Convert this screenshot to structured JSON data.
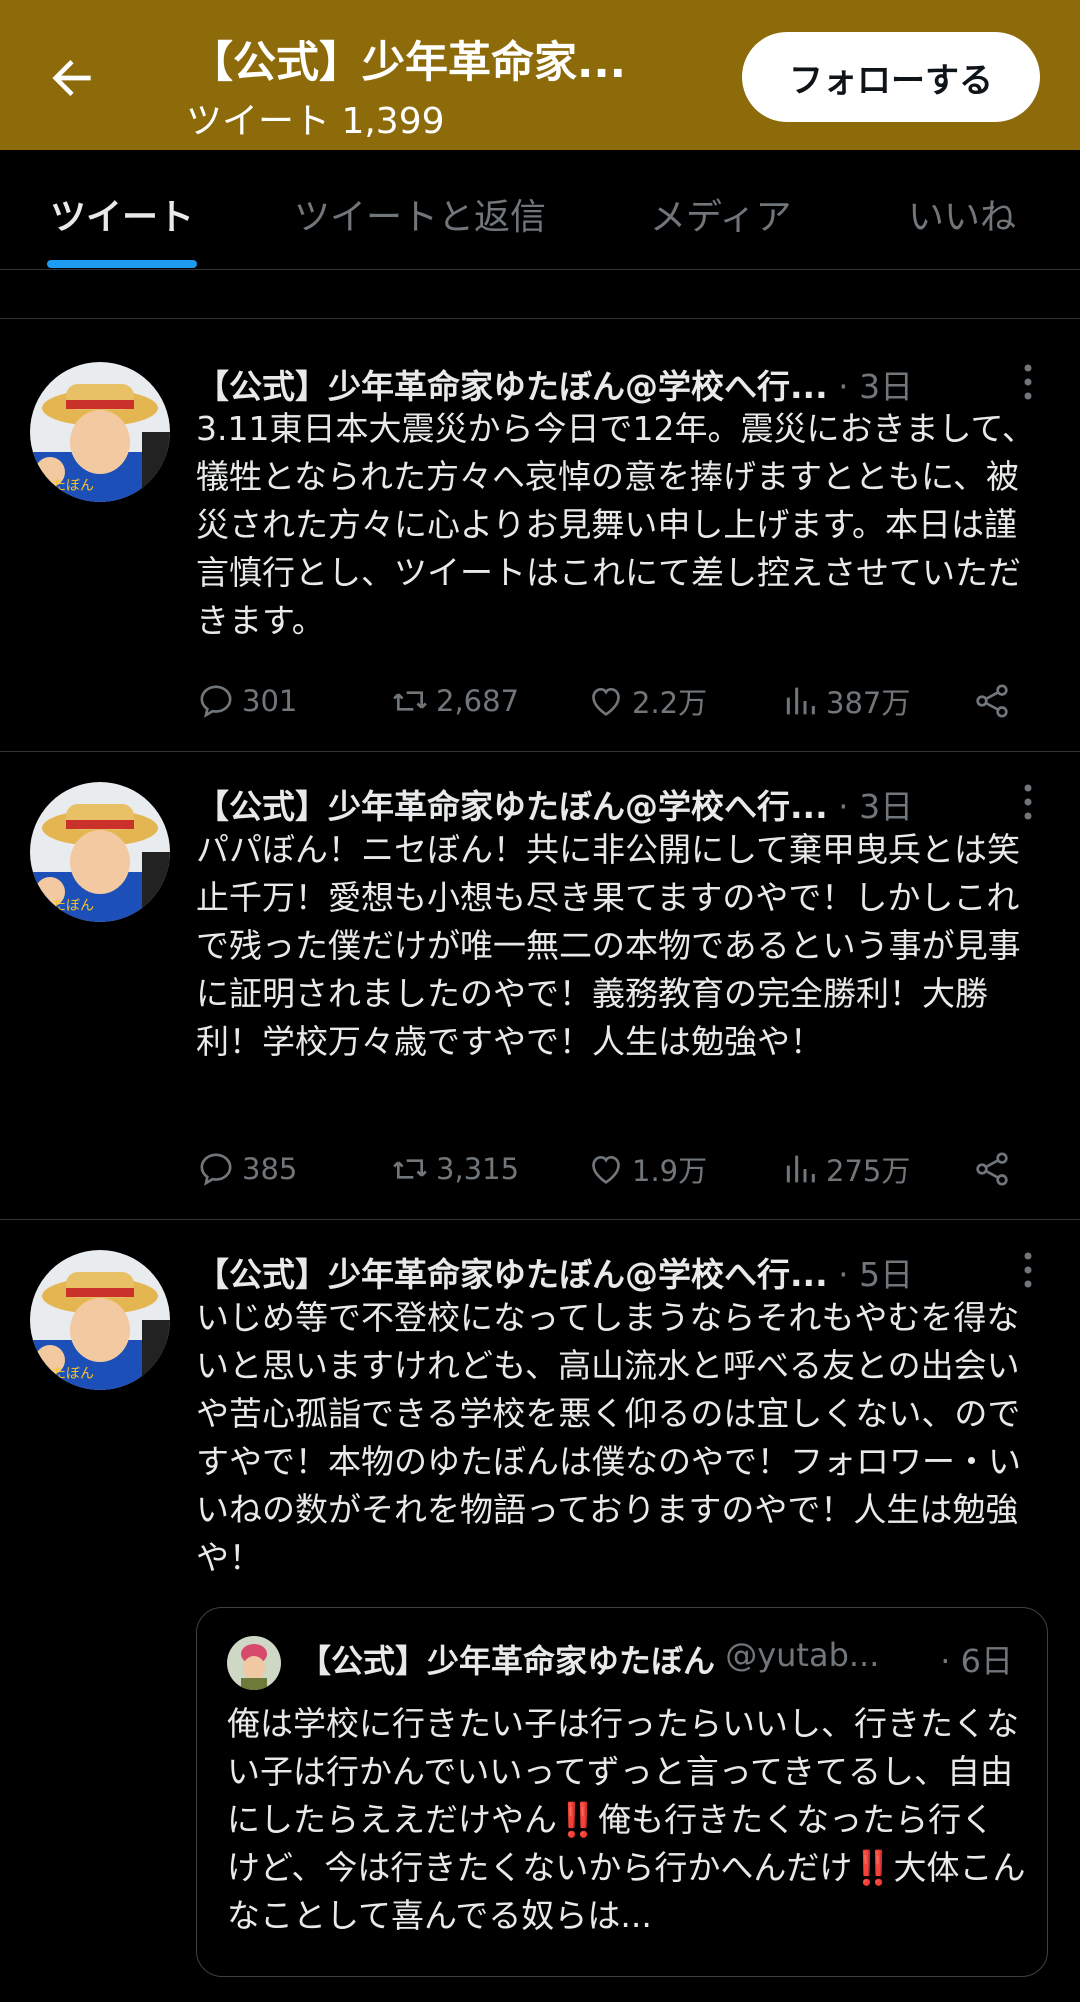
{
  "header": {
    "title": "【公式】少年革命家...",
    "tweet_count": "ツイート 1,399",
    "follow_label": "フォローする"
  },
  "tabs": [
    {
      "label": "ツイート",
      "active": true
    },
    {
      "label": "ツイートと返信",
      "active": false
    },
    {
      "label": "メディア",
      "active": false
    },
    {
      "label": "いいね",
      "active": false
    }
  ],
  "tweets": [
    {
      "name": "【公式】少年革命家ゆたぼん@学校へ行...",
      "time": "· 3日",
      "text": "3.11東日本大震災から今日で12年。震災におきまして、犠牲となられた方々へ哀悼の意を捧げますとともに、被災された方々に心よりお見舞い申し上げます。本日は謹言慎行とし、ツイートはこれにて差し控えさせていただきます。",
      "replies": "301",
      "retweets": "2,687",
      "likes": "2.2万",
      "views": "387万"
    },
    {
      "name": "【公式】少年革命家ゆたぼん@学校へ行...",
      "time": "· 3日",
      "text": "パパぼん！ニセぼん！共に非公開にして棄甲曳兵とは笑止千万！愛想も小想も尽き果てますのやで！しかしこれで残った僕だけが唯一無二の本物であるという事が見事に証明されましたのやで！義務教育の完全勝利！大勝利！学校万々歳ですやで！人生は勉強や！",
      "replies": "385",
      "retweets": "3,315",
      "likes": "1.9万",
      "views": "275万"
    },
    {
      "name": "【公式】少年革命家ゆたぼん@学校へ行...",
      "time": "· 5日",
      "text": "いじめ等で不登校になってしまうならそれもやむを得ないと思いますけれども、高山流水と呼べる友との出会いや苦心孤詣できる学校を悪く仰るのは宜しくない、のですやで！本物のゆたぼんは僕なのやで！フォロワー・いいねの数がそれを物語っておりますのやで！人生は勉強や！"
    }
  ],
  "quote": {
    "name": "【公式】少年革命家ゆたぼん",
    "handle": "@yutab...",
    "time": "· 6日",
    "text": "俺は学校に行きたい子は行ったらいいし、行きたくない子は行かんでいいってずっと言ってきてるし、自由にしたらええだけやん‼️俺も行きたくなったら行くけど、今は行きたくないから行かへんだけ‼️大体こんなことして喜んでる奴らは..."
  },
  "colors": {
    "header_bg": "#8d6b0a",
    "tab_underline": "#1d9bf0",
    "muted": "#71767b"
  }
}
